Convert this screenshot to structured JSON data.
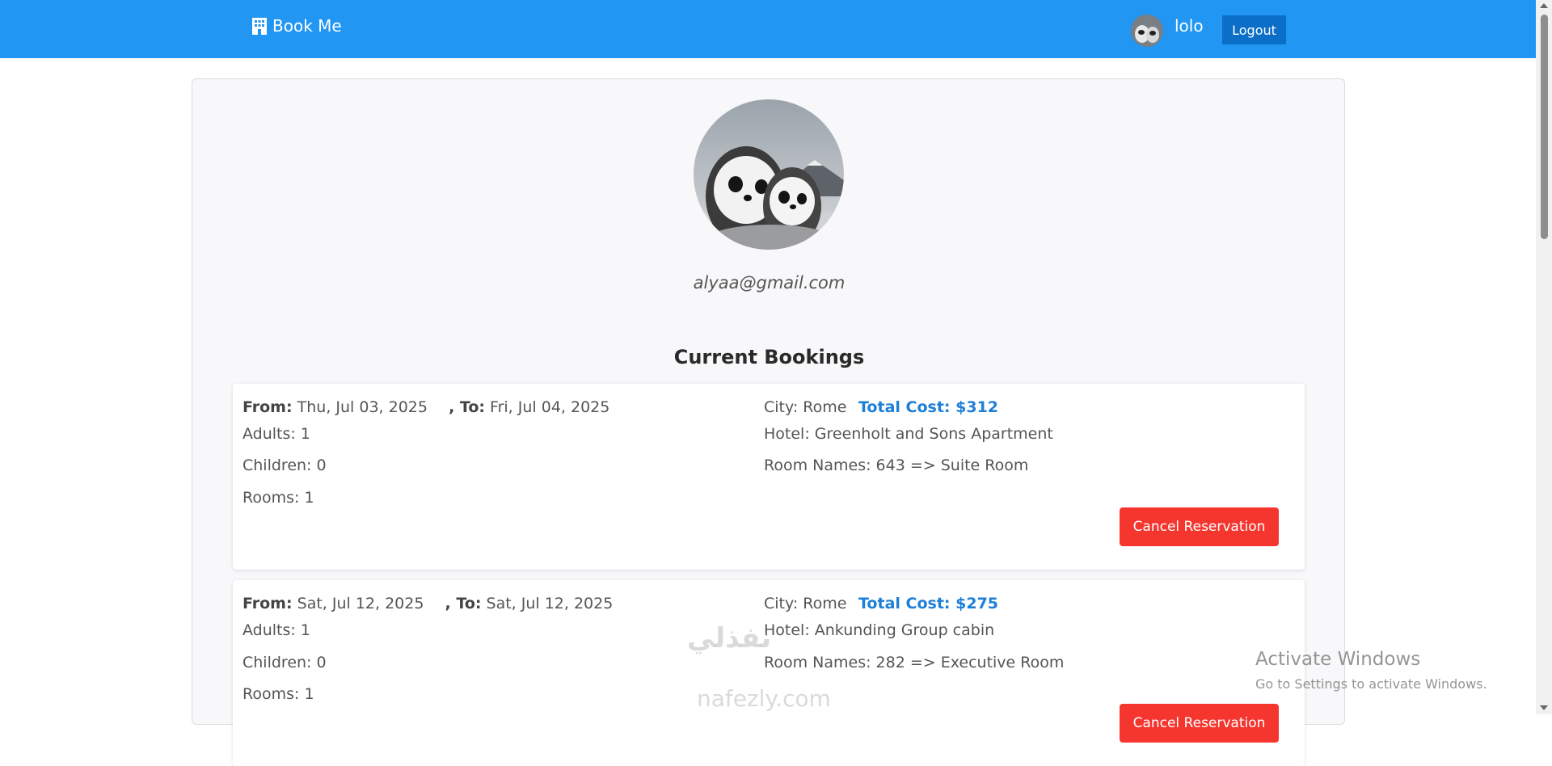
{
  "navbar": {
    "brand": "Book Me",
    "brand_icon": "hotel-icon",
    "username": "lolo",
    "logout_label": "Logout",
    "color": "#2196f3"
  },
  "profile": {
    "email": "alyaa@gmail.com"
  },
  "bookings_title": "Current Bookings",
  "bookings": [
    {
      "from_label": "From:",
      "from": "Thu, Jul 03, 2025",
      "to_label": ", To:",
      "to": "Fri, Jul 04, 2025",
      "adults": "Adults: 1",
      "children": "Children: 0",
      "rooms": "Rooms: 1",
      "city": "City: Rome",
      "total_cost": "Total Cost: $312",
      "hotel": "Hotel: Greenholt and Sons Apartment",
      "room_names": "Room Names: 643 => Suite Room",
      "cancel_label": "Cancel Reservation"
    },
    {
      "from_label": "From:",
      "from": "Sat, Jul 12, 2025",
      "to_label": ", To:",
      "to": "Sat, Jul 12, 2025",
      "adults": "Adults: 1",
      "children": "Children: 0",
      "rooms": "Rooms: 1",
      "city": "City: Rome",
      "total_cost": "Total Cost: $275",
      "hotel": "Hotel: Ankunding Group cabin",
      "room_names": "Room Names: 282 => Executive Room",
      "cancel_label": "Cancel Reservation"
    }
  ],
  "watermark": {
    "arabic": "نفذلي",
    "latin": "nafezly.com"
  },
  "os_notice": {
    "title": "Activate Windows",
    "subtitle": "Go to Settings to activate Windows."
  },
  "colors": {
    "cancel": "#f4362f",
    "cost": "#1e7fd8",
    "logout": "#0b6fc7"
  }
}
